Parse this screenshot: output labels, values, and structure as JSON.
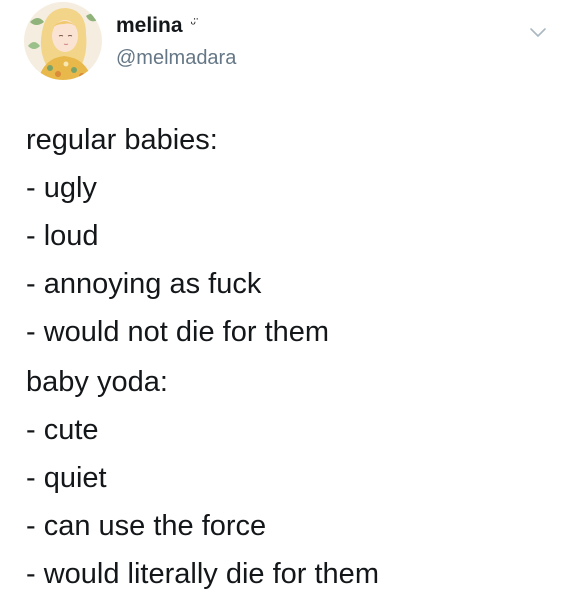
{
  "author": {
    "display_name": "melina",
    "name_emoji": "ᵕ̈",
    "handle": "@melmadara"
  },
  "icons": {
    "avatar": "profile-illustration",
    "menu": "chevron-down-icon"
  },
  "colors": {
    "text": "#14171a",
    "secondary_text": "#657786",
    "chevron": "#aab8c2",
    "background": "#ffffff"
  },
  "tweet": {
    "paragraphs": [
      {
        "lines": [
          "regular babies:",
          "- ugly",
          "- loud",
          "- annoying as fuck",
          "- would not die for them"
        ]
      },
      {
        "lines": [
          "baby yoda:",
          "- cute",
          "- quiet",
          "- can use the force",
          "- would literally die for them"
        ]
      }
    ]
  }
}
